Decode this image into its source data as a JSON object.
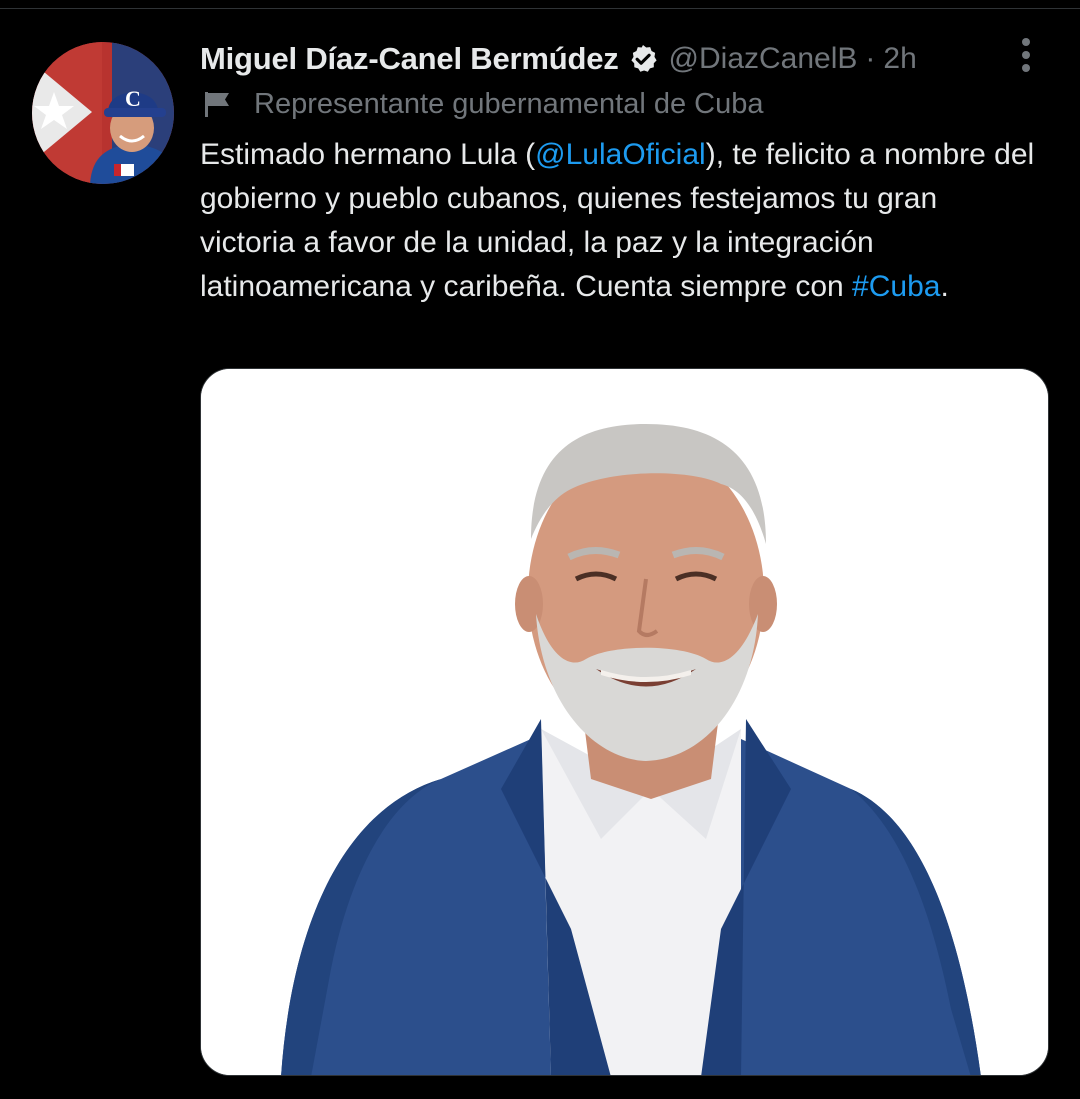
{
  "tweet": {
    "author": {
      "display_name": "Miguel Díaz-Canel Bermúdez",
      "handle": "@DiazCanelB",
      "separator": "·",
      "time": "2h",
      "verified": true,
      "affiliation_label": "Representante gubernamental de Cuba"
    },
    "text": {
      "part1": "Estimado hermano Lula (",
      "mention": "@LulaOficial",
      "part2": "), te felicito a nombre del gobierno y pueblo cubanos, quienes festejamos tu gran victoria a favor de la unidad, la paz y la integración latinoamericana y caribeña. Cuenta siempre con ",
      "hashtag": "#Cuba",
      "part3": "."
    },
    "icons": {
      "verified": "verified-badge-icon",
      "more": "more-options-icon",
      "affiliation": "flag-icon"
    }
  },
  "colors": {
    "background": "#000000",
    "primary_text": "#e7e9ea",
    "secondary_text": "#71767b",
    "link": "#1d9bf0"
  }
}
